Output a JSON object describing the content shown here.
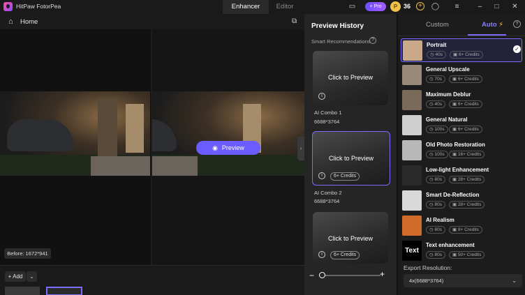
{
  "app": {
    "title": "HitPaw FotorPea"
  },
  "top_tabs": [
    {
      "label": "Enhancer"
    },
    {
      "label": "Editor"
    }
  ],
  "titlebar": {
    "pro_label": "+ Pro",
    "coin_count": "36",
    "coin_add": "+"
  },
  "icons": {
    "home": "home-icon",
    "crop": "crop-icon",
    "settings": "gear-icon",
    "account": "user-icon",
    "menu": "menu-icon"
  },
  "workspace": {
    "home_label": "Home",
    "preview_button": "Preview",
    "size_tag": "Before: 1672*941",
    "add_button": "+ Add",
    "add_dropdown": "⌄"
  },
  "history": {
    "title": "Preview History",
    "smart_label": "Smart Recommendations",
    "cards": [
      {
        "cta": "Click to Preview",
        "credit": "",
        "name": "AI Combo 1",
        "size": "6688*3764"
      },
      {
        "cta": "Click to Preview",
        "credit": "6+ Credits",
        "name": "AI Combo 2",
        "size": "6688*3764"
      },
      {
        "cta": "Click to Preview",
        "credit": "6+ Credits",
        "name": "",
        "size": ""
      }
    ]
  },
  "panel": {
    "tab_custom": "Custom",
    "tab_auto": "Auto",
    "modes": [
      {
        "name": "Portrait",
        "time": "40s",
        "credits": "6+ Credits",
        "selected": true,
        "color": "#c9a98a"
      },
      {
        "name": "General Upscale",
        "time": "70s",
        "credits": "6+ Credits",
        "selected": false,
        "color": "#9a8a7a"
      },
      {
        "name": "Maximum Deblur",
        "time": "40s",
        "credits": "6+ Credits",
        "selected": false,
        "color": "#7a6a5a"
      },
      {
        "name": "General Natural",
        "time": "100s",
        "credits": "6+ Credits",
        "selected": false,
        "color": "#cfcfcf"
      },
      {
        "name": "Old Photo Restoration",
        "time": "100s",
        "credits": "16+ Credits",
        "selected": false,
        "color": "#b8b8b8"
      },
      {
        "name": "Low-light Enhancement",
        "time": "80s",
        "credits": "28+ Credits",
        "selected": false,
        "color": "#2a2a2a"
      },
      {
        "name": "Smart De-Reflection",
        "time": "80s",
        "credits": "28+ Credits",
        "selected": false,
        "color": "#d9d9d9"
      },
      {
        "name": "AI Realism",
        "time": "80s",
        "credits": "8+ Credits",
        "selected": false,
        "color": "#d06a2a"
      },
      {
        "name": "Text enhancement",
        "time": "80s",
        "credits": "50+ Credits",
        "selected": false,
        "color": "#000000",
        "thumb_text": "Text"
      }
    ],
    "export_label": "Export Resolution:",
    "export_value": "4x(6688*3764)"
  },
  "colors": {
    "accent": "#7b6cff",
    "preview_button": "#6b5cff",
    "coin": "#f0c14b"
  }
}
